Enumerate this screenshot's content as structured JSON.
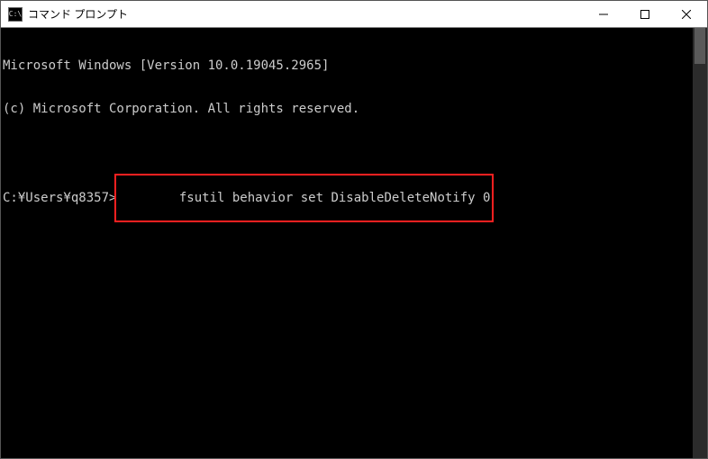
{
  "window": {
    "title": "コマンド プロンプト",
    "icon_label": "cmd-icon"
  },
  "terminal": {
    "line1": "Microsoft Windows [Version 10.0.19045.2965]",
    "line2": "(c) Microsoft Corporation. All rights reserved.",
    "blank": "",
    "prompt": "C:¥Users¥q8357>",
    "command": "fsutil behavior set DisableDeleteNotify 0"
  }
}
